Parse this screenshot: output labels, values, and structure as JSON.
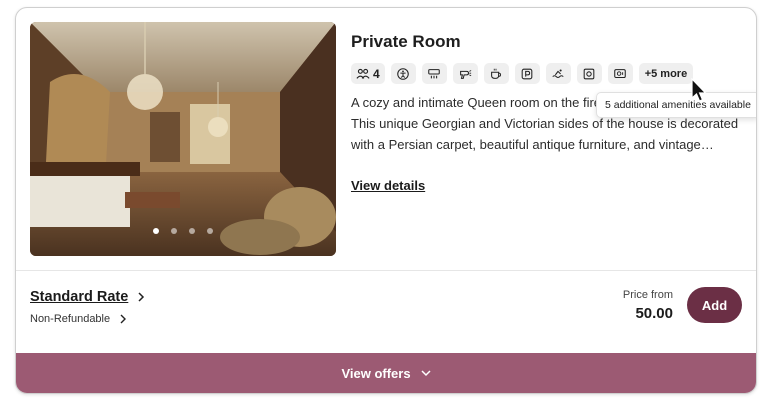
{
  "room": {
    "title": "Private Room",
    "guests": "4",
    "more_amenities": "+5 more",
    "description": "A cozy and intimate Queen room on the fireplace above the library. This unique Georgian and Victorian sides of the house is decorated with a Persian carpet, beautiful antique furniture, and vintage…",
    "view_details": "View details"
  },
  "amenity_icons": [
    "guests-icon",
    "accessibility-icon",
    "air-conditioning-icon",
    "hairdryer-icon",
    "coffee-icon",
    "parking-icon",
    "pool-icon",
    "safe-icon",
    "tv-icon"
  ],
  "tooltip": "5 additional amenities available",
  "rate": {
    "name": "Standard Rate",
    "policy": "Non-Refundable",
    "price_label": "Price from",
    "price": "50.00",
    "add_label": "Add"
  },
  "offers_label": "View offers",
  "carousel": {
    "count": 4,
    "active": 1
  },
  "colors": {
    "primary": "#6b2f45",
    "offers_bar": "#9c5a73"
  }
}
